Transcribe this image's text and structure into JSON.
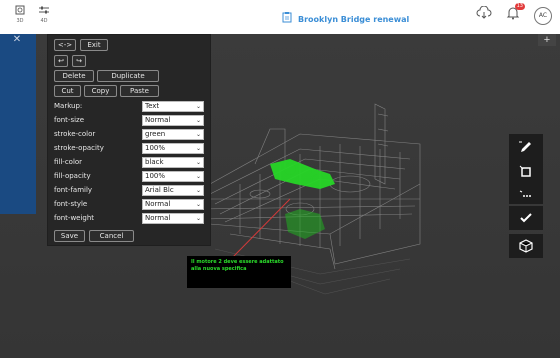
{
  "topbar": {
    "btn_3d": "3D",
    "btn_4d": "4D",
    "project_title": "Brooklyn Bridge renewal",
    "notification_count": "13",
    "avatar_initials": "AC"
  },
  "panel": {
    "exit_label": "Exit",
    "delete_label": "Delete",
    "duplicate_label": "Duplicate",
    "cut_label": "Cut",
    "copy_label": "Copy",
    "paste_label": "Paste",
    "save_label": "Save",
    "cancel_label": "Cancel",
    "properties": [
      {
        "label": "Markup:",
        "value": "Text"
      },
      {
        "label": "font-size",
        "value": "Normal"
      },
      {
        "label": "stroke-color",
        "value": "green"
      },
      {
        "label": "stroke-opacity",
        "value": "100%"
      },
      {
        "label": "fill-color",
        "value": "black"
      },
      {
        "label": "fill-opacity",
        "value": "100%"
      },
      {
        "label": "font-family",
        "value": "Arial Blc"
      },
      {
        "label": "font-style",
        "value": "Normal"
      },
      {
        "label": "font-weight",
        "value": "Normal"
      }
    ]
  },
  "annotation": {
    "text": "Il motore 2 deve essere adattato alla nuova specifica"
  },
  "colors": {
    "accent": "#3b8ed6",
    "sidebar_blue": "#1a4a82",
    "highlight_green": "#2bdc2b",
    "leader_line": "#d13a3a"
  }
}
